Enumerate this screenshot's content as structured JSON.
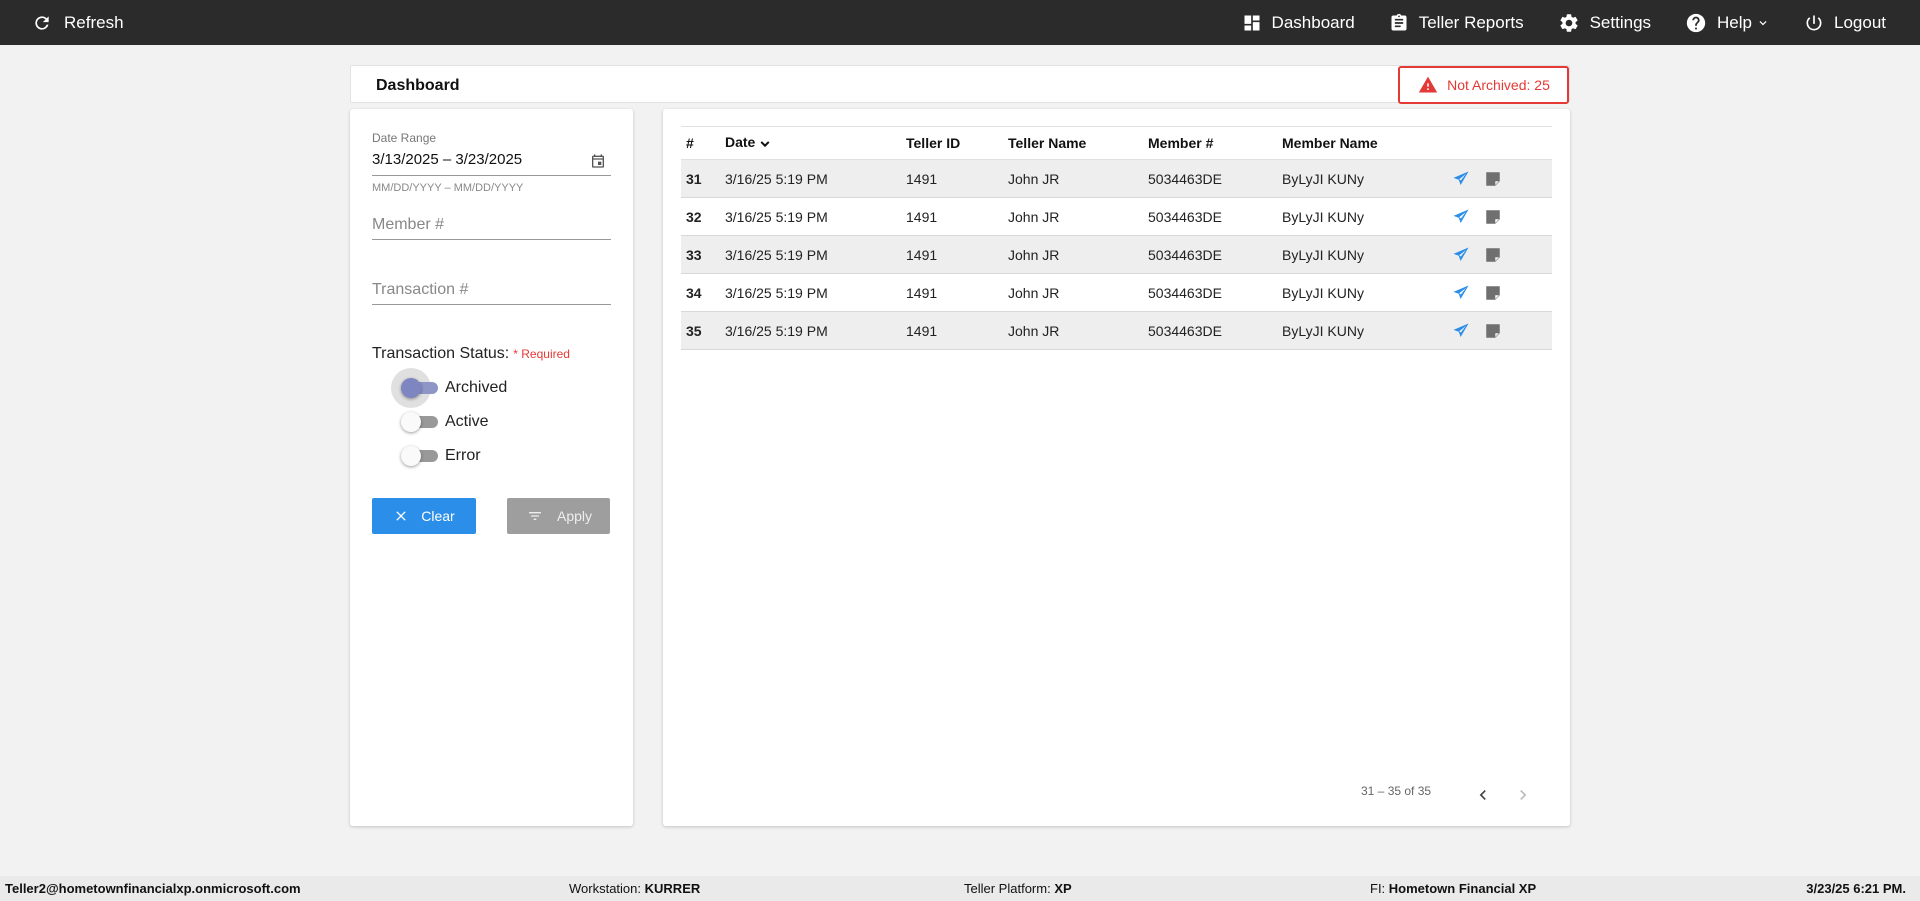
{
  "topbar": {
    "refresh_label": "Refresh",
    "nav": {
      "dashboard": "Dashboard",
      "teller_reports": "Teller Reports",
      "settings": "Settings",
      "help": "Help",
      "logout": "Logout"
    }
  },
  "header": {
    "title": "Dashboard",
    "alert": "Not Archived: 25"
  },
  "filters": {
    "date_range_label": "Date Range",
    "date_range_value": "3/13/2025 – 3/23/2025",
    "date_hint": "MM/DD/YYYY – MM/DD/YYYY",
    "member_placeholder": "Member #",
    "transaction_placeholder": "Transaction #",
    "status_label": "Transaction Status:",
    "required_label": "* Required",
    "statuses": [
      "Archived",
      "Active",
      "Error"
    ],
    "clear_label": "Clear",
    "apply_label": "Apply"
  },
  "table": {
    "columns": [
      "#",
      "Date",
      "Teller ID",
      "Teller Name",
      "Member #",
      "Member Name"
    ],
    "rows": [
      [
        "31",
        "3/16/25 5:19 PM",
        "1491",
        "John JR",
        "5034463DE",
        "ByLyJI KUNy"
      ],
      [
        "32",
        "3/16/25 5:19 PM",
        "1491",
        "John JR",
        "5034463DE",
        "ByLyJI KUNy"
      ],
      [
        "33",
        "3/16/25 5:19 PM",
        "1491",
        "John JR",
        "5034463DE",
        "ByLyJI KUNy"
      ],
      [
        "34",
        "3/16/25 5:19 PM",
        "1491",
        "John JR",
        "5034463DE",
        "ByLyJI KUNy"
      ],
      [
        "35",
        "3/16/25 5:19 PM",
        "1491",
        "John JR",
        "5034463DE",
        "ByLyJI KUNy"
      ]
    ]
  },
  "pager": {
    "range_text": "31 – 35 of 35"
  },
  "footer": {
    "user": "Teller2@hometownfinancialxp.onmicrosoft.com",
    "workstation_label": "Workstation:",
    "workstation_value": "KURRER",
    "platform_label": "Teller Platform:",
    "platform_value": "XP",
    "fi_label": "FI:",
    "fi_value": "Hometown Financial XP",
    "datetime": "3/23/25 6:21 PM."
  },
  "colors": {
    "topbar_bg": "#2b2b2b",
    "accent_blue": "#2b8ee8",
    "alert_red": "#e53935",
    "apply_disabled": "#9e9e9e"
  },
  "icons": {
    "refresh": "refresh-icon",
    "dashboard": "dashboard-icon",
    "teller_reports": "clipboard-icon",
    "settings": "gear-icon",
    "help": "help-circle-icon",
    "logout": "power-icon",
    "alert": "warning-icon",
    "calendar": "calendar-icon",
    "clear": "close-icon",
    "apply": "filter-icon",
    "send": "send-icon",
    "note": "note-icon"
  }
}
